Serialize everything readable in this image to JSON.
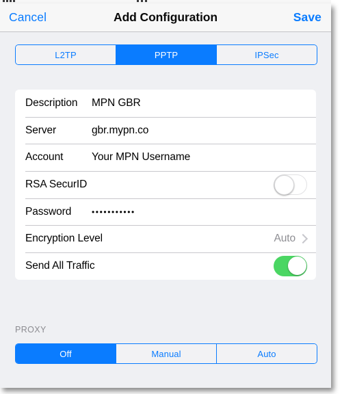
{
  "navbar": {
    "cancel_label": "Cancel",
    "title": "Add Configuration",
    "save_label": "Save"
  },
  "vpn_type": {
    "options": [
      "L2TP",
      "PPTP",
      "IPSec"
    ],
    "selected": "PPTP"
  },
  "fields": [
    {
      "label": "Description",
      "value": "MPN GBR",
      "type": "text"
    },
    {
      "label": "Server",
      "value": "gbr.mypn.co",
      "type": "text"
    },
    {
      "label": "Account",
      "value": "Your MPN Username",
      "type": "text"
    },
    {
      "label": "RSA SecurID",
      "value": "",
      "type": "switch",
      "switch_state": "off"
    },
    {
      "label": "Password",
      "value": "•••••••••••",
      "type": "password"
    },
    {
      "label": "Encryption Level",
      "value": "Auto",
      "type": "disclosure"
    },
    {
      "label": "Send All Traffic",
      "value": "",
      "type": "switch",
      "switch_state": "on"
    }
  ],
  "proxy": {
    "section_label": "PROXY",
    "options": [
      "Off",
      "Manual",
      "Auto"
    ],
    "selected": "Off"
  },
  "colors": {
    "accent_blue": "#0a7cff",
    "switch_on_green": "#4bd663",
    "background": "#eff0f3",
    "card": "#ffffff",
    "separator": "#c8c7cc",
    "secondary_text": "#8e8e93"
  }
}
